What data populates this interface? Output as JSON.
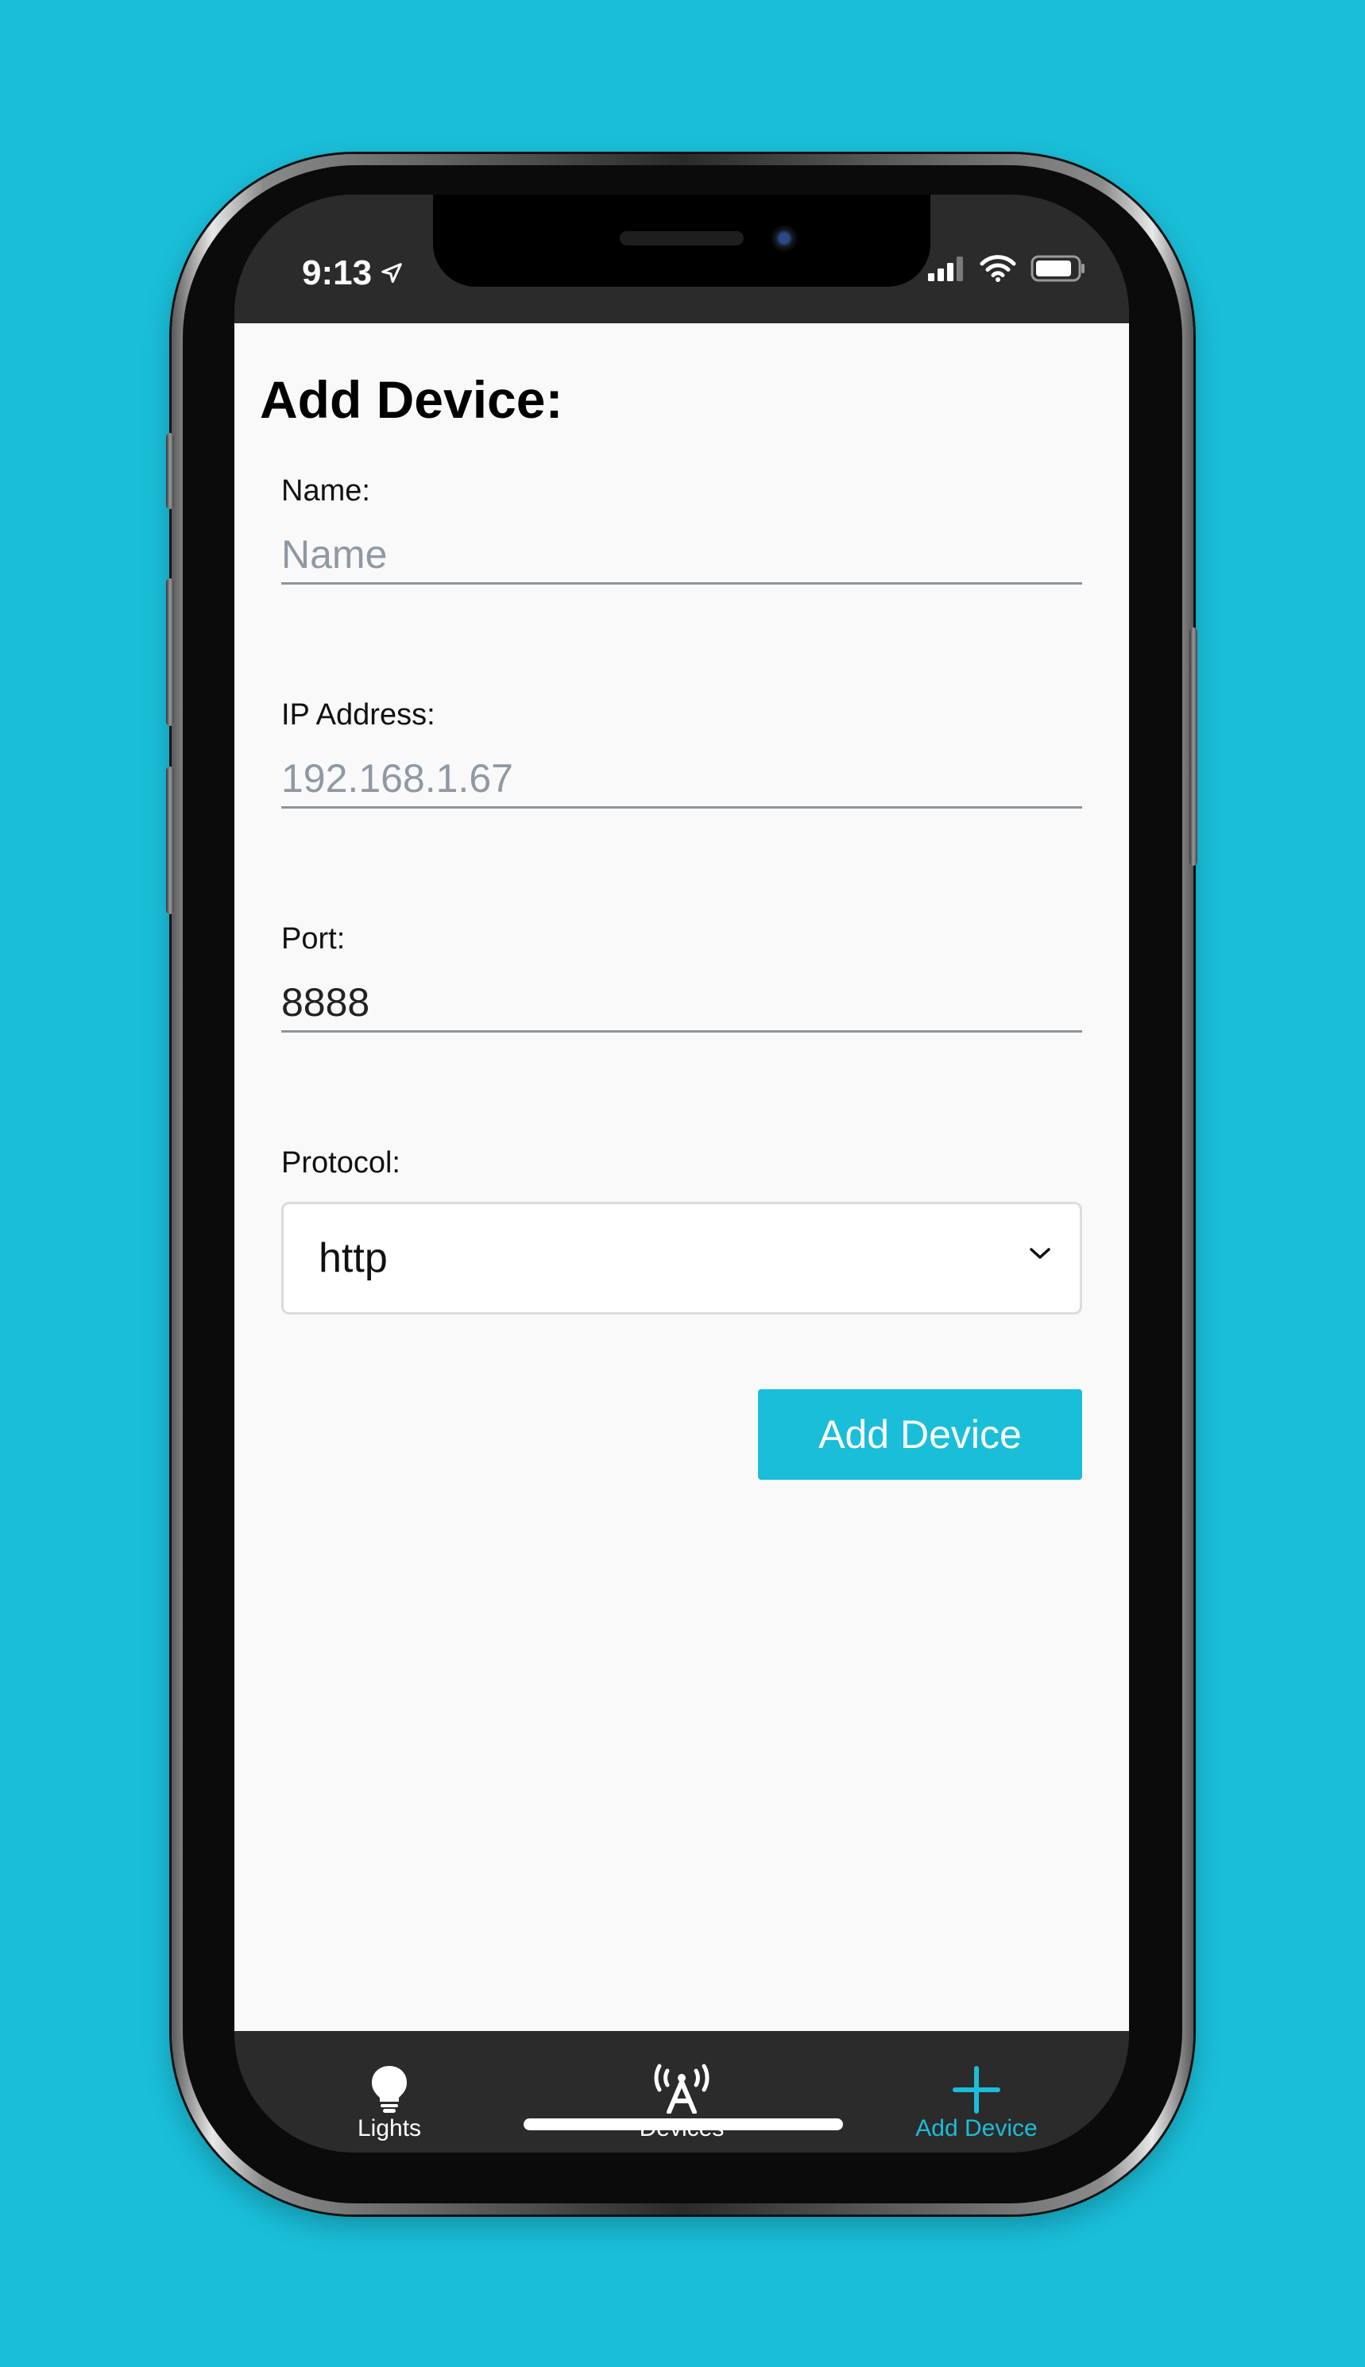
{
  "status_bar": {
    "time": "9:13",
    "location_icon": "location-arrow-icon",
    "signal_icon": "cellular-signal-icon",
    "wifi_icon": "wifi-icon",
    "battery_icon": "battery-icon"
  },
  "page": {
    "title": "Add Device:"
  },
  "form": {
    "name": {
      "label": "Name:",
      "placeholder": "Name",
      "value": ""
    },
    "ip": {
      "label": "IP Address:",
      "placeholder": "192.168.1.67",
      "value": ""
    },
    "port": {
      "label": "Port:",
      "placeholder": "",
      "value": "8888"
    },
    "protocol": {
      "label": "Protocol:",
      "selected": "http"
    },
    "submit_label": "Add Device"
  },
  "tabs": [
    {
      "label": "Lights",
      "icon": "lightbulb-icon",
      "active": false
    },
    {
      "label": "Devices",
      "icon": "antenna-icon",
      "active": false
    },
    {
      "label": "Add Device",
      "icon": "plus-icon",
      "active": true
    }
  ],
  "colors": {
    "accent": "#1abed9",
    "background": "#1abed9",
    "tabbar": "#2b2b2b",
    "content_bg": "#f9f9f9"
  }
}
